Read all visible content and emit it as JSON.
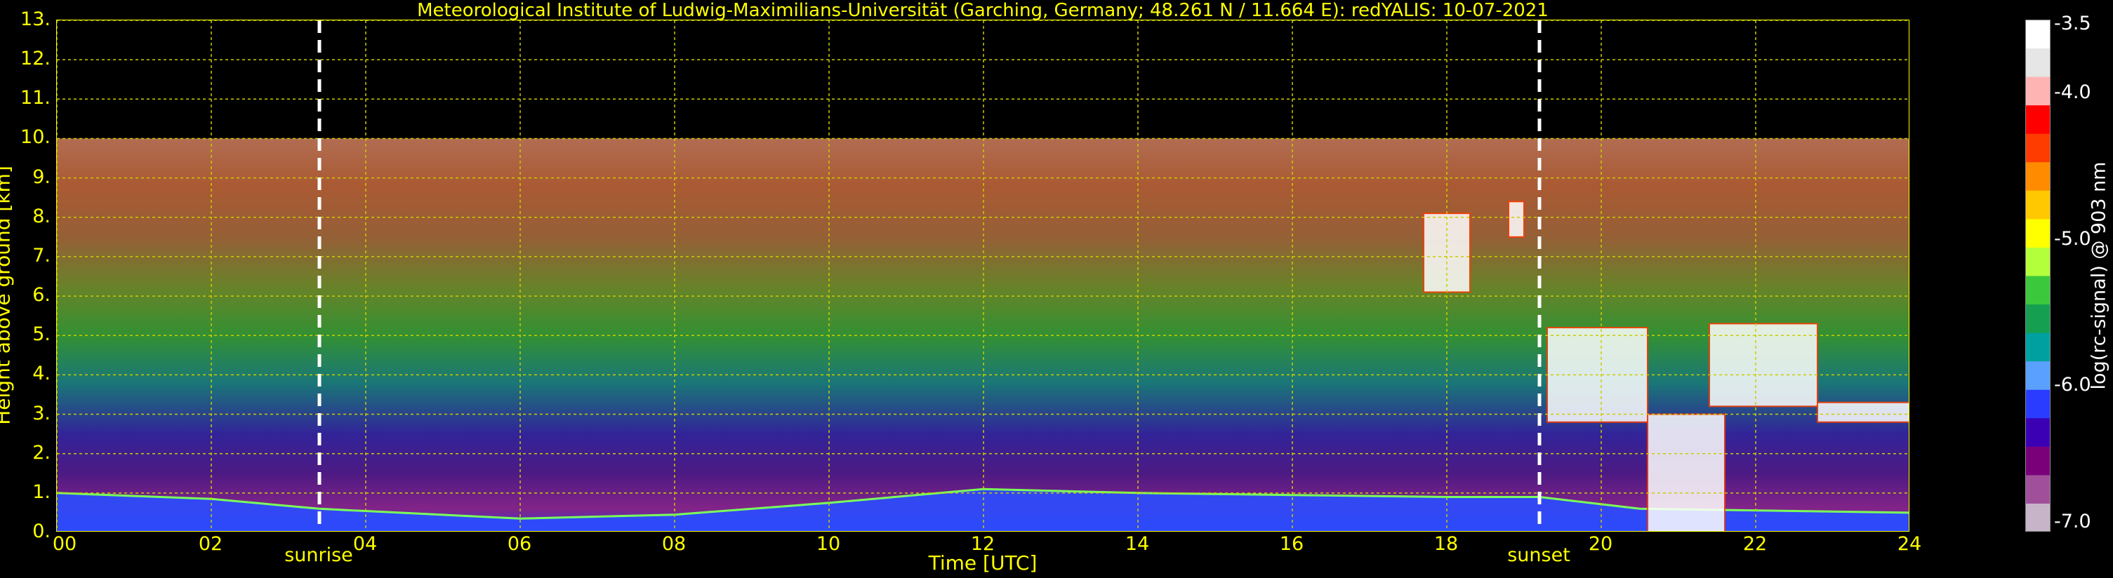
{
  "chart_data": {
    "type": "heatmap",
    "title": "Meteorological Institute of Ludwig-Maximilians-Universität (Garching, Germany; 48.261 N / 11.664 E):    redYALIS: 10-07-2021",
    "xlabel": "Time [UTC]",
    "ylabel": "Height above ground [km]",
    "xlim": [
      0,
      24
    ],
    "ylim": [
      0,
      13
    ],
    "x_ticks": [
      "00",
      "02",
      "04",
      "06",
      "08",
      "10",
      "12",
      "14",
      "16",
      "18",
      "20",
      "22",
      "24"
    ],
    "y_ticks": [
      "0.",
      "1.",
      "2.",
      "3.",
      "4.",
      "5.",
      "6.",
      "7.",
      "8.",
      "9.",
      "10.",
      "11.",
      "12.",
      "13."
    ],
    "grid": true,
    "data_top_km": 10,
    "events": [
      {
        "label": "sunrise",
        "time": 3.4
      },
      {
        "label": "sunset",
        "time": 19.2
      }
    ],
    "boundary_layer_top": [
      {
        "time": 0,
        "height": 1.0
      },
      {
        "time": 2,
        "height": 0.85
      },
      {
        "time": 3.4,
        "height": 0.6
      },
      {
        "time": 6,
        "height": 0.35
      },
      {
        "time": 8,
        "height": 0.45
      },
      {
        "time": 10,
        "height": 0.75
      },
      {
        "time": 12,
        "height": 1.1
      },
      {
        "time": 14,
        "height": 1.0
      },
      {
        "time": 16,
        "height": 0.95
      },
      {
        "time": 18,
        "height": 0.9
      },
      {
        "time": 19.2,
        "height": 0.9
      },
      {
        "time": 20.5,
        "height": 0.6
      },
      {
        "time": 24,
        "height": 0.5
      }
    ],
    "cloud_layers": [
      {
        "time_start": 17.7,
        "time_end": 18.3,
        "base": 6.1,
        "top": 8.1
      },
      {
        "time_start": 18.8,
        "time_end": 19.0,
        "base": 7.5,
        "top": 8.4
      },
      {
        "time_start": 19.3,
        "time_end": 20.6,
        "base": 2.8,
        "top": 5.2
      },
      {
        "time_start": 20.6,
        "time_end": 21.6,
        "base": 0.0,
        "top": 3.0
      },
      {
        "time_start": 21.4,
        "time_end": 22.8,
        "base": 3.2,
        "top": 5.3
      },
      {
        "time_start": 22.8,
        "time_end": 24.0,
        "base": 2.8,
        "top": 3.3
      }
    ],
    "colorbar": {
      "label": "log(rc-signal) @ 903 nm",
      "range": [
        -7.0,
        -3.5
      ],
      "ticks": [
        "-3.5",
        "-4.0",
        "-5.0",
        "-6.0",
        "-7.0"
      ],
      "colors": [
        "#c8b4c8",
        "#a0509a",
        "#7a007a",
        "#3c00b4",
        "#2a3cff",
        "#5aa0ff",
        "#00a0a0",
        "#14a050",
        "#3cc83c",
        "#b4ff3c",
        "#ffff00",
        "#ffc800",
        "#ff8c00",
        "#ff3c00",
        "#ff0000",
        "#ffb4b4",
        "#e6e6e6",
        "#ffffff"
      ]
    }
  }
}
